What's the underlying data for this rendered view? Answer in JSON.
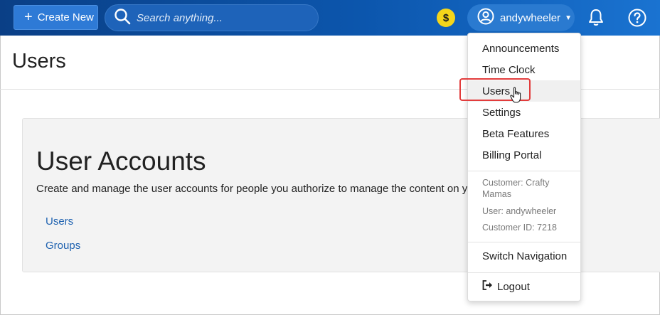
{
  "topbar": {
    "create_label": "Create New",
    "search_placeholder": "Search anything...",
    "coin_symbol": "$",
    "username": "andywheeler",
    "accent": "#0c56ad"
  },
  "page": {
    "title": "Users"
  },
  "panel": {
    "title": "User Accounts",
    "description": "Create and manage the user accounts for people you authorize to manage the content on your wel",
    "links": [
      "Users",
      "Groups"
    ]
  },
  "menu": {
    "items": [
      "Announcements",
      "Time Clock",
      "Users",
      "Settings",
      "Beta Features",
      "Billing Portal"
    ],
    "active_item": "Users",
    "info": {
      "customer": "Customer: Crafty Mamas",
      "user": "User: andywheeler",
      "customer_id": "Customer ID: 7218"
    },
    "switch_label": "Switch Navigation",
    "logout_label": "Logout",
    "highlight_color": "#e23c3c"
  }
}
